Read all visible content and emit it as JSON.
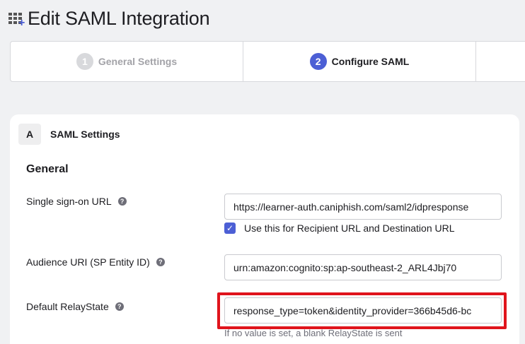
{
  "header": {
    "title": "Edit SAML Integration",
    "icon": "integration-add-icon"
  },
  "stepper": {
    "steps": [
      {
        "number": "1",
        "label": "General Settings",
        "state": "inactive"
      },
      {
        "number": "2",
        "label": "Configure SAML",
        "state": "active"
      },
      {
        "number": "",
        "label": "",
        "state": "inactive"
      }
    ]
  },
  "section": {
    "badge": "A",
    "title": "SAML Settings",
    "group_title": "General"
  },
  "fields": {
    "sso_url": {
      "label": "Single sign-on URL",
      "value": "https://learner-auth.caniphish.com/saml2/idpresponse"
    },
    "recipient_checkbox": {
      "label": "Use this for Recipient URL and Destination URL",
      "checked": true
    },
    "audience_uri": {
      "label": "Audience URI (SP Entity ID)",
      "value": "urn:amazon:cognito:sp:ap-southeast-2_ARL4Jbj70"
    },
    "relay_state": {
      "label": "Default RelayState",
      "value": "response_type=token&identity_provider=366b45d6-bc",
      "hint": "If no value is set, a blank RelayState is sent"
    }
  },
  "colors": {
    "accent": "#4c5fd5",
    "highlight": "#e0141c",
    "background": "#f0f1f3"
  }
}
